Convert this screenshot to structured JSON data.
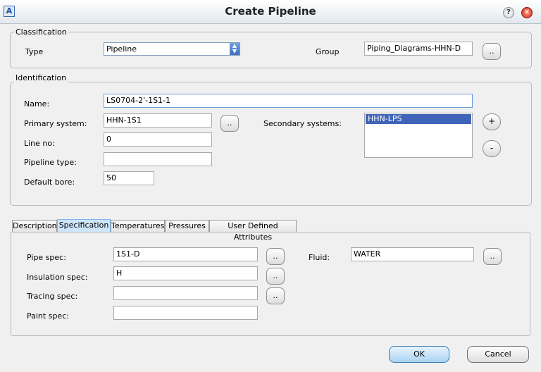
{
  "window": {
    "title": "Create Pipeline",
    "app_icon": "A",
    "help_icon": "?",
    "close_icon": "✕"
  },
  "classification": {
    "legend": "Classification",
    "type_label": "Type",
    "type_value": "Pipeline",
    "group_label": "Group",
    "group_value": "Piping_Diagrams-HHN-D",
    "browse_label": ".."
  },
  "identification": {
    "legend": "Identification",
    "name_label": "Name:",
    "name_value": "LS0704-2'-1S1-1",
    "primary_system_label": "Primary system:",
    "primary_system_value": "HHN-1S1",
    "secondary_systems_label": "Secondary systems:",
    "secondary_systems": [
      "HHN-LPS"
    ],
    "line_no_label": "Line no:",
    "line_no_value": "0",
    "pipeline_type_label": "Pipeline type:",
    "pipeline_type_value": "",
    "default_bore_label": "Default bore:",
    "default_bore_value": "50",
    "browse_label": "..",
    "add_label": "+",
    "remove_label": "-"
  },
  "tabs": [
    {
      "label": "Description"
    },
    {
      "label": "Specification"
    },
    {
      "label": "Temperatures"
    },
    {
      "label": "Pressures"
    },
    {
      "label": "User Defined Attributes"
    }
  ],
  "specification": {
    "pipe_spec_label": "Pipe spec:",
    "pipe_spec_value": "1S1-D",
    "insulation_spec_label": "Insulation spec:",
    "insulation_spec_value": "H",
    "tracing_spec_label": "Tracing spec:",
    "tracing_spec_value": "",
    "paint_spec_label": "Paint spec:",
    "paint_spec_value": "",
    "fluid_label": "Fluid:",
    "fluid_value": "WATER",
    "browse_label": ".."
  },
  "footer": {
    "ok_label": "OK",
    "cancel_label": "Cancel"
  }
}
